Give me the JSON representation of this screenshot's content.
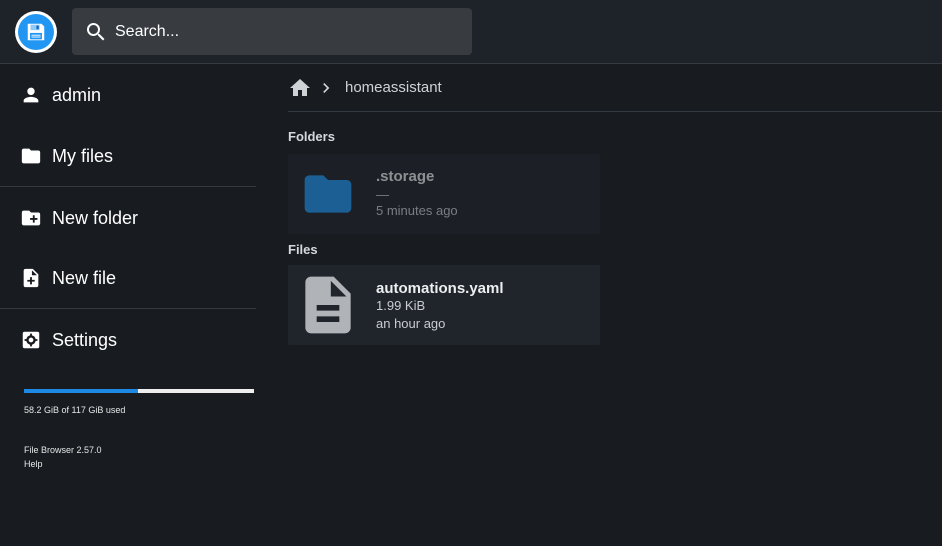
{
  "header": {
    "logo_icon": "floppy-disk-icon",
    "search": {
      "placeholder": "Search...",
      "icon": "search-icon"
    }
  },
  "sidebar": {
    "items": [
      {
        "label": "admin",
        "icon": "person-icon"
      },
      {
        "label": "My files",
        "icon": "folder-icon"
      },
      {
        "label": "New folder",
        "icon": "create-new-folder-icon"
      },
      {
        "label": "New file",
        "icon": "note-add-icon"
      },
      {
        "label": "Settings",
        "icon": "settings-icon"
      }
    ],
    "usage": {
      "text": "58.2 GiB of 117 GiB used",
      "fraction": 0.497
    },
    "footer": {
      "version": "File Browser 2.57.0",
      "help": "Help"
    }
  },
  "breadcrumb": {
    "home_icon": "home-icon",
    "path": "homeassistant"
  },
  "folders": {
    "title": "Folders",
    "items": [
      {
        "name": ".storage",
        "size": "—",
        "modified": "5 minutes ago"
      }
    ]
  },
  "files": {
    "title": "Files",
    "items": [
      {
        "name": "automations.yaml",
        "size": "1.99 KiB",
        "modified": "an hour ago"
      }
    ]
  },
  "colors": {
    "background": "#181c21",
    "accent": "#2196f3",
    "card": "#20252b",
    "usage_fill": "#1e88e5"
  }
}
